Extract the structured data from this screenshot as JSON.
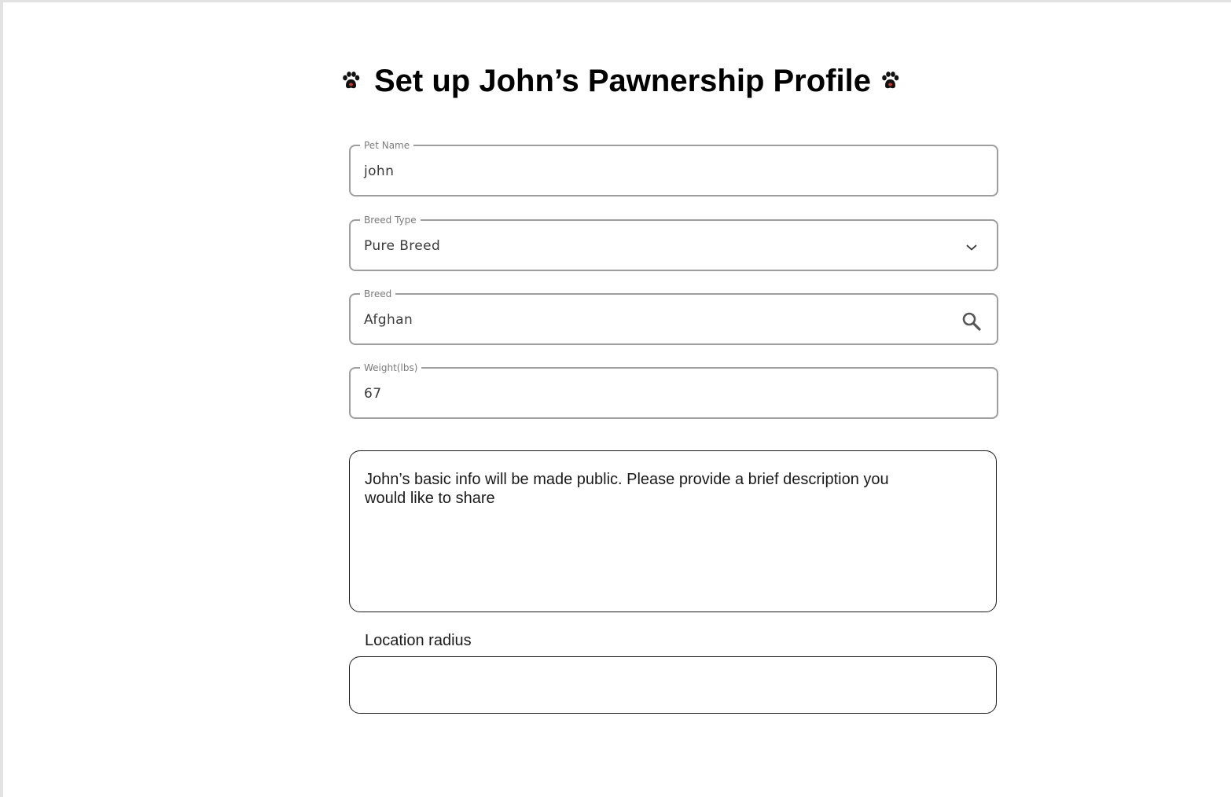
{
  "header": {
    "title": "Set up John’s Pawnership Profile",
    "left_icon": "paw-icon",
    "right_icon": "paw-icon"
  },
  "form": {
    "pet_name": {
      "label": "Pet Name",
      "value": "john"
    },
    "breed_type": {
      "label": "Breed Type",
      "value": "Pure Breed",
      "icon": "chevron-down-icon"
    },
    "breed": {
      "label": "Breed",
      "value": "Afghan",
      "icon": "search-icon"
    },
    "weight": {
      "label": "Weight(lbs)",
      "value": "67"
    },
    "description": {
      "text": "John’s basic info will be made public. Please provide a brief description you would like to share"
    },
    "location_radius": {
      "label": "Location radius",
      "value": ""
    }
  },
  "colors": {
    "field_border": "#9e9e9e",
    "legend_text": "#7a7a7a",
    "paw_toes": "#111111",
    "paw_pad_accent": "#c0392b"
  }
}
